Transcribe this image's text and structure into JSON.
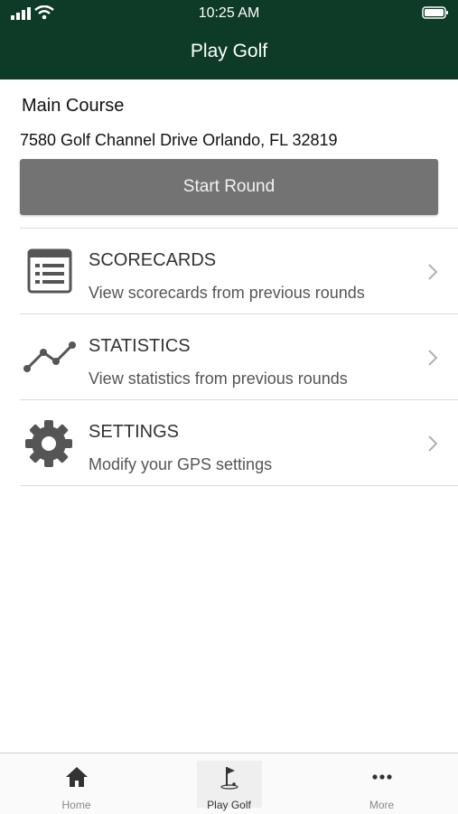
{
  "status_bar": {
    "time": "10:25 AM"
  },
  "header": {
    "title": "Play Golf"
  },
  "course": {
    "name": "Main Course",
    "address": "7580 Golf Channel Drive Orlando, FL 32819",
    "start_label": "Start Round"
  },
  "menu": [
    {
      "title": "SCORECARDS",
      "subtitle": "View scorecards from previous rounds",
      "icon": "scorecard-icon"
    },
    {
      "title": "STATISTICS",
      "subtitle": "View statistics from previous rounds",
      "icon": "line-chart-icon"
    },
    {
      "title": "SETTINGS",
      "subtitle": "Modify your GPS settings",
      "icon": "gear-icon"
    }
  ],
  "tabs": [
    {
      "label": "Home",
      "icon": "home-icon"
    },
    {
      "label": "Play Golf",
      "icon": "golf-flag-icon",
      "active": true
    },
    {
      "label": "More",
      "icon": "more-icon"
    }
  ],
  "colors": {
    "header_bg": "#0d3b27",
    "button_bg": "#737373"
  }
}
